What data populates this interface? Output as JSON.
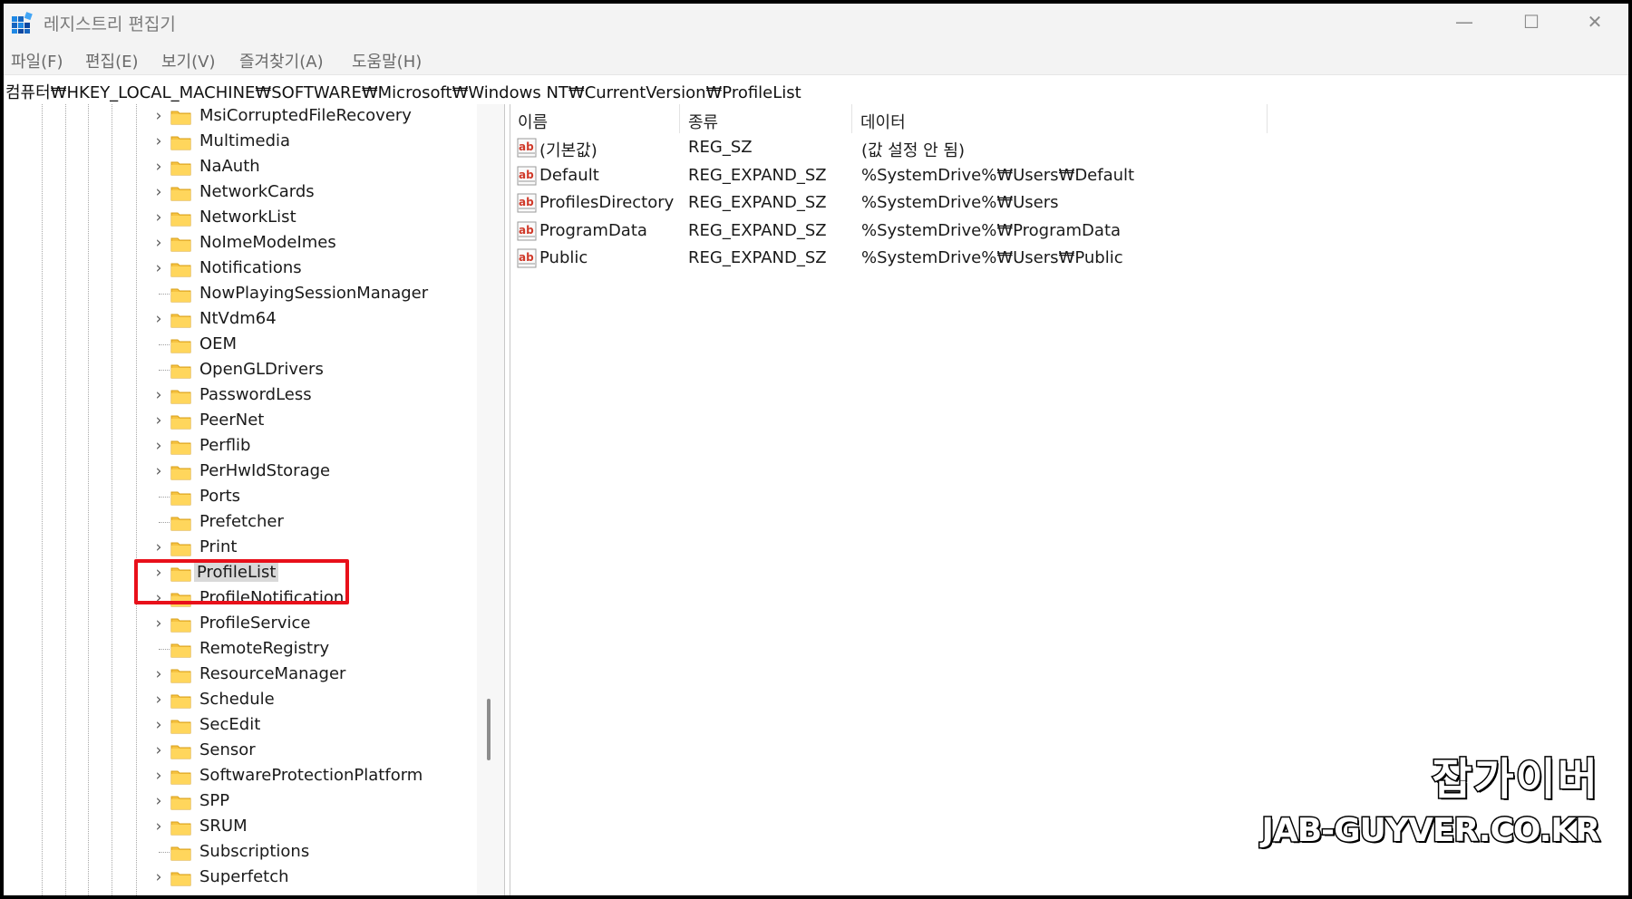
{
  "window": {
    "title": "레지스트리 편집기",
    "controls": {
      "minimize": "—",
      "maximize": "☐",
      "close": "✕"
    }
  },
  "menu": [
    "파일(F)",
    "편집(E)",
    "보기(V)",
    "즐겨찾기(A)",
    "도움말(H)"
  ],
  "address": "컴퓨터₩HKEY_LOCAL_MACHINE₩SOFTWARE₩Microsoft₩Windows NT₩CurrentVersion₩ProfileList",
  "tree": {
    "items": [
      {
        "label": "MsiCorruptedFileRecovery",
        "expandable": true
      },
      {
        "label": "Multimedia",
        "expandable": true
      },
      {
        "label": "NaAuth",
        "expandable": true
      },
      {
        "label": "NetworkCards",
        "expandable": true
      },
      {
        "label": "NetworkList",
        "expandable": true
      },
      {
        "label": "NoImeModeImes",
        "expandable": true
      },
      {
        "label": "Notifications",
        "expandable": true
      },
      {
        "label": "NowPlayingSessionManager",
        "expandable": false
      },
      {
        "label": "NtVdm64",
        "expandable": true
      },
      {
        "label": "OEM",
        "expandable": false
      },
      {
        "label": "OpenGLDrivers",
        "expandable": false
      },
      {
        "label": "PasswordLess",
        "expandable": true
      },
      {
        "label": "PeerNet",
        "expandable": true
      },
      {
        "label": "Perflib",
        "expandable": true
      },
      {
        "label": "PerHwIdStorage",
        "expandable": true
      },
      {
        "label": "Ports",
        "expandable": false
      },
      {
        "label": "Prefetcher",
        "expandable": false
      },
      {
        "label": "Print",
        "expandable": true
      },
      {
        "label": "ProfileList",
        "expandable": true,
        "selected": true
      },
      {
        "label": "ProfileNotification",
        "expandable": true
      },
      {
        "label": "ProfileService",
        "expandable": true
      },
      {
        "label": "RemoteRegistry",
        "expandable": false
      },
      {
        "label": "ResourceManager",
        "expandable": true
      },
      {
        "label": "Schedule",
        "expandable": true
      },
      {
        "label": "SecEdit",
        "expandable": true
      },
      {
        "label": "Sensor",
        "expandable": true
      },
      {
        "label": "SoftwareProtectionPlatform",
        "expandable": true
      },
      {
        "label": "SPP",
        "expandable": true
      },
      {
        "label": "SRUM",
        "expandable": true
      },
      {
        "label": "Subscriptions",
        "expandable": false
      },
      {
        "label": "Superfetch",
        "expandable": true
      }
    ]
  },
  "columns": {
    "name": "이름",
    "type": "종류",
    "data": "데이터"
  },
  "values": [
    {
      "name": "(기본값)",
      "type": "REG_SZ",
      "data": "(값 설정 안 됨)"
    },
    {
      "name": "Default",
      "type": "REG_EXPAND_SZ",
      "data": "%SystemDrive%₩Users₩Default"
    },
    {
      "name": "ProfilesDirectory",
      "type": "REG_EXPAND_SZ",
      "data": "%SystemDrive%₩Users"
    },
    {
      "name": "ProgramData",
      "type": "REG_EXPAND_SZ",
      "data": "%SystemDrive%₩ProgramData"
    },
    {
      "name": "Public",
      "type": "REG_EXPAND_SZ",
      "data": "%SystemDrive%₩Users₩Public"
    }
  ],
  "watermark": {
    "title": "잡가이버",
    "url": "JAB-GUYVER.CO.KR"
  },
  "colors": {
    "highlight": "#e8101a",
    "folder": "#f6c342",
    "selection": "#d9d9d9"
  }
}
